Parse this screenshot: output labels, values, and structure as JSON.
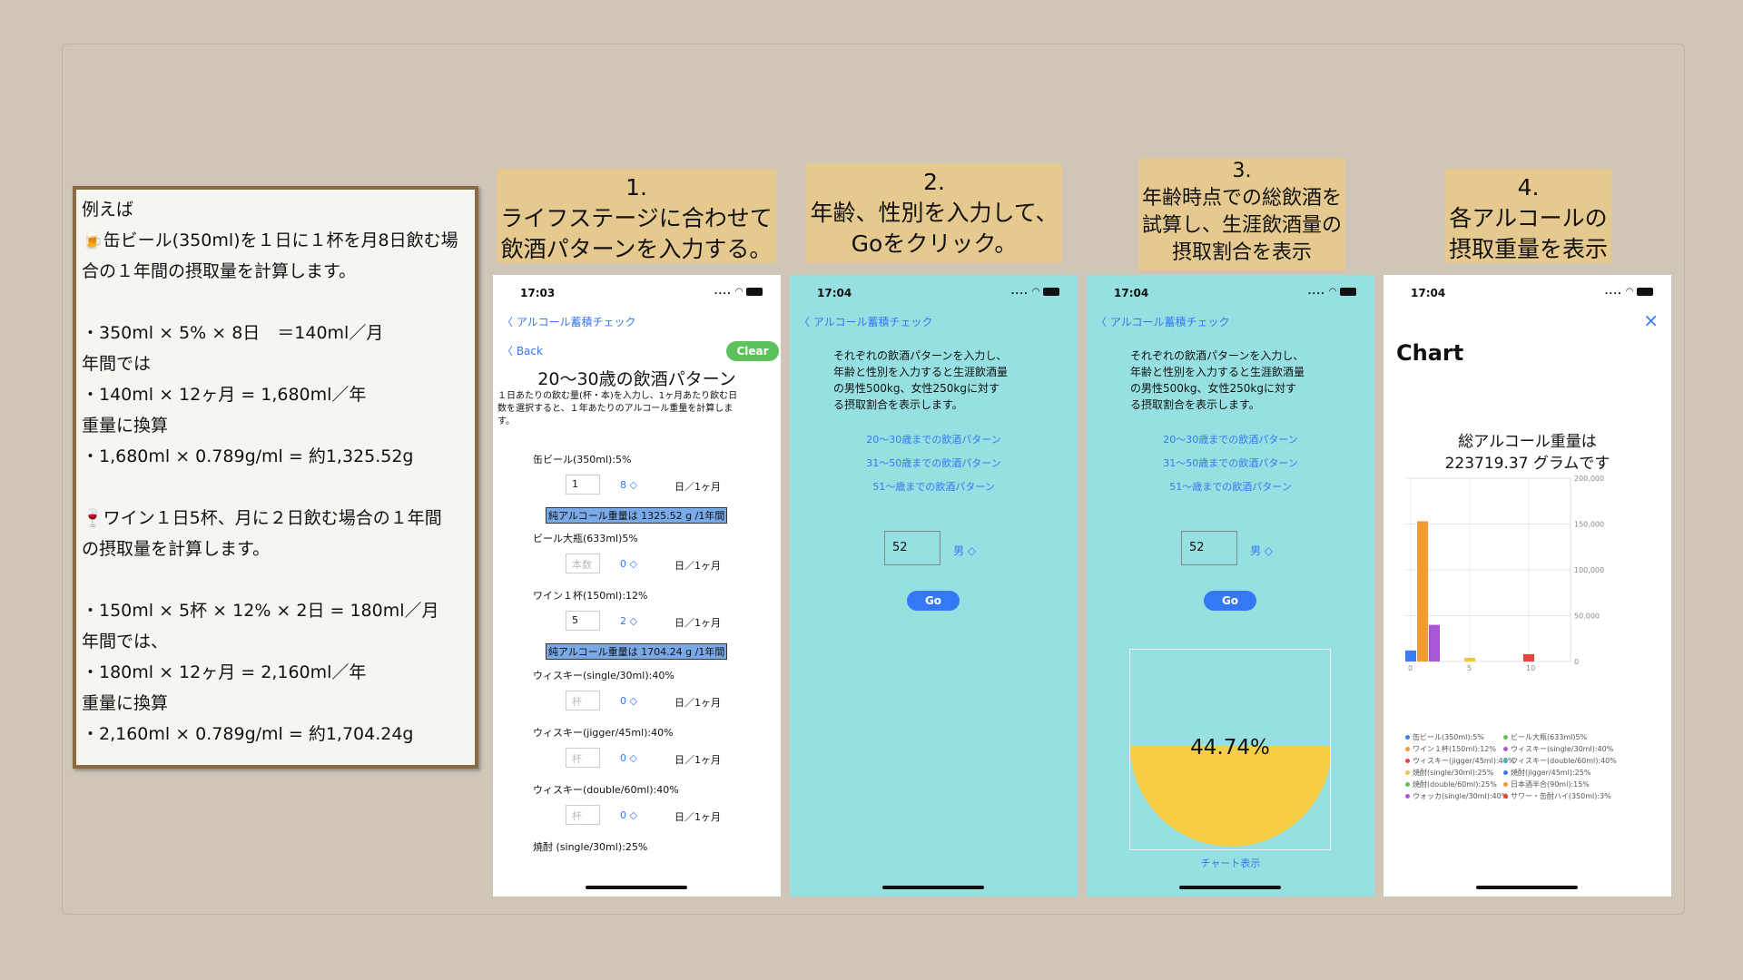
{
  "note": {
    "lines": [
      "例えば",
      "🍺缶ビール(350ml)を１日に１杯を月8日飲む場",
      "合の１年間の摂取量を計算します。",
      "",
      "・350ml × 5%  × 8日　＝140ml／月",
      "年間では",
      "・140ml  × 12ヶ月 = 1,680ml／年",
      "重量に換算",
      "・1,680ml  × 0.789g/ml  = 約1,325.52g",
      "",
      "🍷ワイン１日5杯、月に２日飲む場合の１年間",
      "の摂取量を計算します。",
      "",
      "・150ml × 5杯 × 12%  × 2日 = 180ml／月",
      "年間では、",
      "・180ml  × 12ヶ月 = 2,160ml／年",
      "重量に換算",
      "・2,160ml  × 0.789g/ml  = 約1,704.24g"
    ]
  },
  "steps": [
    {
      "lines": [
        "1.",
        "ライフステージに合わせて",
        "飲酒パターンを入力する。"
      ]
    },
    {
      "lines": [
        "2.",
        "年齢、性別を入力して、",
        "Goをクリック。"
      ]
    },
    {
      "lines": [
        "3.",
        "年齢時点での総飲酒を",
        "試算し、生涯飲酒量の",
        "摂取割合を表示"
      ]
    },
    {
      "lines": [
        "4.",
        "各アルコールの",
        "摂取重量を表示"
      ]
    }
  ],
  "screen1": {
    "time": "17:03",
    "status": "....",
    "nav_back": "アルコール蓄積チェック",
    "back": "Back",
    "clear": "Clear",
    "title": "20〜30歳の飲酒パターン",
    "desc": [
      "１日あたりの飲む量(杯・本)を入力し、1ヶ月あたり飲む日",
      "数を選択すると、１年あたりのアルコール重量を計算しま",
      "す。"
    ],
    "unit": "日／1ヶ月",
    "items": [
      {
        "label": "缶ビール(350ml):5%",
        "qty": "1",
        "days": "8 ◇",
        "result": "純アルコール重量は 1325.52 g /1年間"
      },
      {
        "label": "ビール大瓶(633ml)5%",
        "qty": "本数",
        "days": "0 ◇"
      },
      {
        "label": "ワイン１杯(150ml):12%",
        "qty": "5",
        "days": "2 ◇",
        "result": "純アルコール重量は 1704.24 g /1年間"
      },
      {
        "label": "ウィスキー(single/30ml):40%",
        "qty": "杯",
        "days": "0 ◇"
      },
      {
        "label": "ウィスキー(jigger/45ml):40%",
        "qty": "杯",
        "days": "0 ◇"
      },
      {
        "label": "ウィスキー(double/60ml):40%",
        "qty": "杯",
        "days": "0 ◇"
      },
      {
        "label": "焼酎 (single/30ml):25%"
      }
    ]
  },
  "screen2": {
    "time": "17:04",
    "status": "....",
    "nav_back": "アルコール蓄積チェック",
    "desc": [
      "それぞれの飲酒パターンを入力し、",
      "年齢と性別を入力すると生涯飲酒量",
      "の男性500kg、女性250kgに対す",
      "る摂取割合を表示します。"
    ],
    "links": [
      "20〜30歳までの飲酒パターン",
      "31〜50歳までの飲酒パターン",
      "51〜歳までの飲酒パターン"
    ],
    "age": "52",
    "sex": "男 ◇",
    "go": "Go"
  },
  "screen3": {
    "time": "17:04",
    "status": "....",
    "nav_back": "アルコール蓄積チェック",
    "desc": [
      "それぞれの飲酒パターンを入力し、",
      "年齢と性別を入力すると生涯飲酒量",
      "の男性500kg、女性250kgに対す",
      "る摂取割合を表示します。"
    ],
    "links": [
      "20〜30歳までの飲酒パターン",
      "31〜50歳までの飲酒パターン",
      "51〜歳までの飲酒パターン"
    ],
    "age": "52",
    "sex": "男 ◇",
    "go": "Go",
    "percent": "44.74%",
    "percent_value": 44.74,
    "chart_link": "チャート表示",
    "fill_color": "#f6cd45"
  },
  "screen4": {
    "time": "17:04",
    "status": "....",
    "close": "×",
    "title": "Chart",
    "total": [
      "総アルコール重量は",
      "223719.37 グラムです"
    ]
  },
  "chart_data": {
    "type": "bar",
    "ylim": [
      0,
      200000
    ],
    "yticks": [
      "200,000",
      "150,000",
      "100,000",
      "50,000",
      "0"
    ],
    "xticks": [
      "0",
      "5",
      "10"
    ],
    "bars": [
      {
        "x": 0,
        "value": 12000,
        "color": "#3b7cf6"
      },
      {
        "x": 1,
        "value": 153000,
        "color": "#f29a33"
      },
      {
        "x": 2,
        "value": 40000,
        "color": "#a855d6"
      },
      {
        "x": 5,
        "value": 4000,
        "color": "#f4c542"
      },
      {
        "x": 10,
        "value": 8000,
        "color": "#e8453c"
      }
    ],
    "legend": [
      {
        "name": "缶ビール(350ml):5%",
        "color": "#3b7cf6"
      },
      {
        "name": "ビール大瓶(633ml)5%",
        "color": "#5bc15b"
      },
      {
        "name": "ワイン１杯(150ml):12%",
        "color": "#f29a33"
      },
      {
        "name": "ウィスキー(single/30ml):40%",
        "color": "#a855d6"
      },
      {
        "name": "ウィスキー(jigger/45ml):40%",
        "color": "#e8453c"
      },
      {
        "name": "ウィスキー(double/60ml):40%",
        "color": "#3bb3c9"
      },
      {
        "name": "焼酎(single/30ml):25%",
        "color": "#f4c542"
      },
      {
        "name": "焼酎(jigger/45ml):25%",
        "color": "#3b7cf6"
      },
      {
        "name": "焼酎(double/60ml):25%",
        "color": "#5bc15b"
      },
      {
        "name": "日本酒半合(90ml):15%",
        "color": "#f29a33"
      },
      {
        "name": "ウォッカ(single/30ml):40%",
        "color": "#a855d6"
      },
      {
        "name": "サワー・缶酎ハイ(350ml):3%",
        "color": "#e8453c"
      }
    ]
  }
}
